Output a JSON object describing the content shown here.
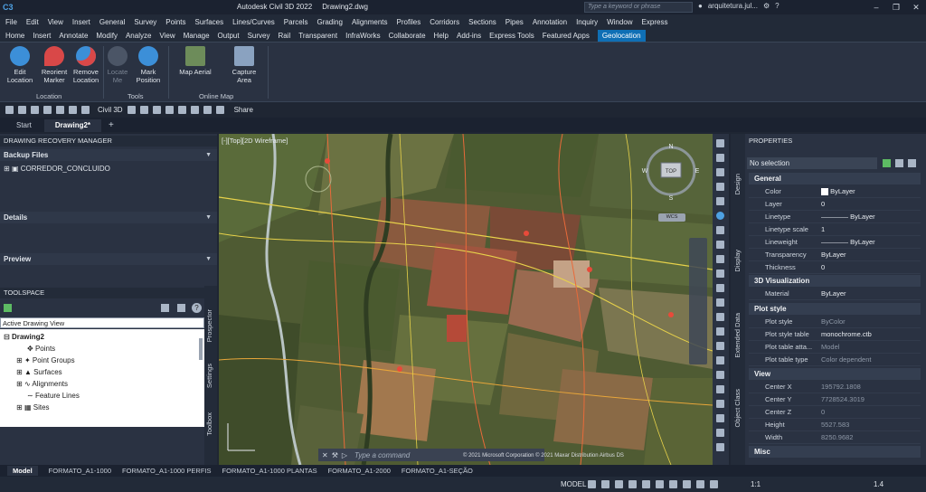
{
  "title": {
    "app": "Autodesk Civil 3D 2022",
    "file": "Drawing2.dwg",
    "search_placeholder": "Type a keyword or phrase",
    "user": "arquitetura.jul..."
  },
  "menu": [
    "File",
    "Edit",
    "View",
    "Insert",
    "General",
    "Survey",
    "Points",
    "Surfaces",
    "Lines/Curves",
    "Parcels",
    "Grading",
    "Alignments",
    "Profiles",
    "Corridors",
    "Sections",
    "Pipes",
    "Annotation",
    "Inquiry",
    "Window",
    "Express"
  ],
  "ribbon_tabs": [
    "Home",
    "Insert",
    "Annotate",
    "Modify",
    "Analyze",
    "View",
    "Manage",
    "Output",
    "Survey",
    "Rail",
    "Transparent",
    "InfraWorks",
    "Collaborate",
    "Help",
    "Add-ins",
    "Express Tools",
    "Featured Apps",
    "Geolocation"
  ],
  "ribbon": {
    "buttons": [
      {
        "l1": "Edit",
        "l2": "Location"
      },
      {
        "l1": "Reorient",
        "l2": "Marker"
      },
      {
        "l1": "Remove",
        "l2": "Location"
      },
      {
        "l1": "Locate",
        "l2": "Me"
      },
      {
        "l1": "Mark",
        "l2": "Position"
      },
      {
        "l1": "Map Aerial",
        "l2": ""
      },
      {
        "l1": "Capture",
        "l2": "Area"
      }
    ],
    "panels": [
      "Location",
      "Tools",
      "Online Map"
    ]
  },
  "qat": {
    "workspace": "Civil 3D",
    "share": "Share"
  },
  "doc_tabs": [
    "Start",
    "Drawing2*"
  ],
  "recovery": {
    "title": "DRAWING RECOVERY MANAGER",
    "backup_files": "Backup Files",
    "file": "CORREDOR_CONCLUIDO",
    "details": "Details",
    "preview": "Preview"
  },
  "toolspace": {
    "title": "TOOLSPACE",
    "view": "Active Drawing View",
    "tree": [
      "Drawing2",
      "Points",
      "Point Groups",
      "Surfaces",
      "Alignments",
      "Feature Lines",
      "Sites"
    ],
    "vtabs": [
      "Prospector",
      "Settings",
      "Toolbox"
    ]
  },
  "viewport": {
    "label": "[-][Top][2D Wireframe]",
    "command_placeholder": "Type a command",
    "attribution": "© 2021 Microsoft Corporation  © 2021 Maxar  Distribution Airbus DS",
    "compass": {
      "n": "N",
      "s": "S",
      "e": "E",
      "w": "W",
      "top": "TOP",
      "wcs": "WCS"
    }
  },
  "properties": {
    "title": "PROPERTIES",
    "selection": "No selection",
    "side_tabs": [
      "Design",
      "Display",
      "Extended Data",
      "Object Class"
    ],
    "categories": [
      {
        "name": "General",
        "rows": [
          {
            "k": "Color",
            "v": "ByLayer"
          },
          {
            "k": "Layer",
            "v": "0"
          },
          {
            "k": "Linetype",
            "v": "ByLayer"
          },
          {
            "k": "Linetype scale",
            "v": "1"
          },
          {
            "k": "Lineweight",
            "v": "ByLayer"
          },
          {
            "k": "Transparency",
            "v": "ByLayer"
          },
          {
            "k": "Thickness",
            "v": "0"
          }
        ]
      },
      {
        "name": "3D Visualization",
        "rows": [
          {
            "k": "Material",
            "v": "ByLayer"
          }
        ]
      },
      {
        "name": "Plot style",
        "rows": [
          {
            "k": "Plot style",
            "v": "ByColor"
          },
          {
            "k": "Plot style table",
            "v": "monochrome.ctb"
          },
          {
            "k": "Plot table atta...",
            "v": "Model"
          },
          {
            "k": "Plot table type",
            "v": "Color dependent"
          }
        ]
      },
      {
        "name": "View",
        "rows": [
          {
            "k": "Center X",
            "v": "195792.1808"
          },
          {
            "k": "Center Y",
            "v": "7728524.3019"
          },
          {
            "k": "Center Z",
            "v": "0"
          },
          {
            "k": "Height",
            "v": "5527.583"
          },
          {
            "k": "Width",
            "v": "8250.9682"
          }
        ]
      },
      {
        "name": "Misc",
        "rows": []
      }
    ]
  },
  "layout_tabs": [
    "Model",
    "FORMATO_A1-1000",
    "FORMATO_A1-1000 PERFIS",
    "FORMATO_A1-1000 PLANTAS",
    "FORMATO_A1-2000",
    "FORMATO_A1-SEÇÃO"
  ],
  "status": {
    "model": "MODEL",
    "scale": "1:1",
    "zoom": "1.4"
  },
  "colors": {
    "accent": "#0f6fb5",
    "panel": "#2a3242",
    "dark": "#1b2230"
  }
}
